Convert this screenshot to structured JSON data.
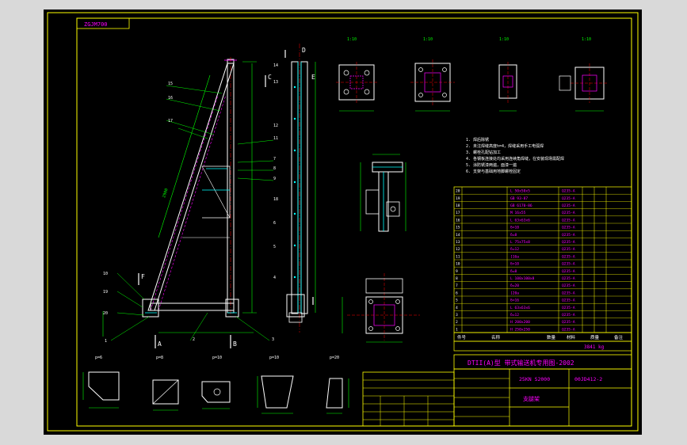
{
  "drawing": {
    "top_label": "ZGJM700",
    "view_labels": [
      "A",
      "B",
      "C",
      "D",
      "E",
      "F"
    ],
    "callouts": [
      "15",
      "16",
      "17",
      "11",
      "12",
      "13",
      "14",
      "7",
      "8",
      "9",
      "6",
      "5",
      "4",
      "3",
      "2",
      "1",
      "10",
      "19",
      "20",
      "18"
    ],
    "detail_scales": [
      "1:10",
      "1:10",
      "1:10",
      "1:10"
    ],
    "small_part_labels": [
      "p=6",
      "p=8",
      "p=10",
      "p=10",
      "p=20"
    ]
  },
  "title_block": {
    "title": "DTII(A)型 带式输送机专用图-2002",
    "drawing_no": "00JD412-2",
    "spec": "25KN S2000",
    "part_name": "支腿架",
    "weight": "3841 kg",
    "header_labels": [
      "件号",
      "名称",
      "数量",
      "材料",
      "质量",
      "备注"
    ]
  },
  "notes": [
    "1. 焊后除锈",
    "2. 未注焊缝高度h=4，焊缝采用手工电弧焊",
    "3. 螺栓孔配钻加工",
    "4. 各钢板连接处均采用连续角焊缝，在安装现场需配焊",
    "5. 涂防锈漆两遍，面漆一遍",
    "6. 支架与基础用地脚螺栓固定"
  ],
  "bom_rows": [
    {
      "no": "20",
      "spec": "L 50x50x5",
      "mat": "Q235-A"
    },
    {
      "no": "19",
      "spec": "GB 93-87",
      "mat": "Q235-A"
    },
    {
      "no": "18",
      "spec": "GB 6170-86",
      "mat": "Q235-A"
    },
    {
      "no": "17",
      "spec": "M 16x55",
      "mat": "Q235-A"
    },
    {
      "no": "16",
      "spec": "L 63x63x6",
      "mat": "Q235-A"
    },
    {
      "no": "15",
      "spec": "δ=10",
      "mat": "Q235-A"
    },
    {
      "no": "14",
      "spec": "δ=8",
      "mat": "Q235-A"
    },
    {
      "no": "13",
      "spec": "L 75x75x8",
      "mat": "Q235-A"
    },
    {
      "no": "12",
      "spec": "δ=12",
      "mat": "Q235-A"
    },
    {
      "no": "11",
      "spec": "[16a",
      "mat": "Q235-A"
    },
    {
      "no": "10",
      "spec": "δ=10",
      "mat": "Q235-A"
    },
    {
      "no": "9",
      "spec": "δ=8",
      "mat": "Q235-A"
    },
    {
      "no": "8",
      "spec": "L 100x100x8",
      "mat": "Q235-A"
    },
    {
      "no": "7",
      "spec": "δ=20",
      "mat": "Q235-A"
    },
    {
      "no": "6",
      "spec": "[20a",
      "mat": "Q235-A"
    },
    {
      "no": "5",
      "spec": "δ=16",
      "mat": "Q235-A"
    },
    {
      "no": "4",
      "spec": "L 63x63x6",
      "mat": "Q235-A"
    },
    {
      "no": "3",
      "spec": "δ=12",
      "mat": "Q235-A"
    },
    {
      "no": "2",
      "spec": "H 200x200",
      "mat": "Q235-A"
    },
    {
      "no": "1",
      "spec": "H 250x250",
      "mat": "Q235-A"
    }
  ],
  "colors": {
    "frame_bg": "#000000",
    "border": "#ffff00",
    "dim": "#00ff00",
    "part": "#ffffff",
    "hidden": "#ff00ff",
    "centerline": "#ff0000",
    "steel": "#00ffff",
    "text_magenta": "#ff00ff",
    "table_line": "#ffff00",
    "outer_bg": "#d9d9d9"
  }
}
